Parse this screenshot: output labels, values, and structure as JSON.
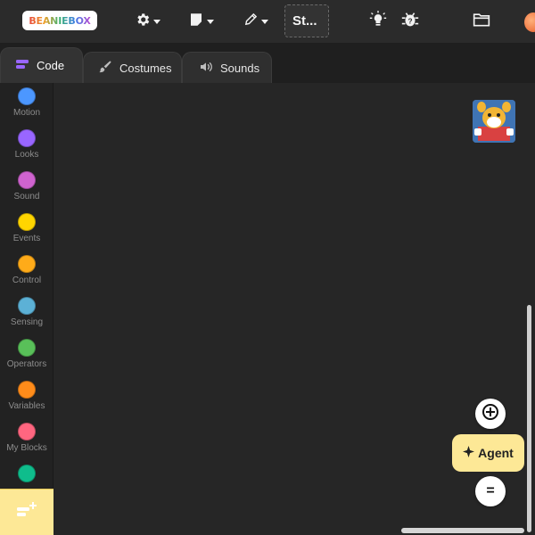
{
  "menubar": {
    "logo_text": "BEANIEBOX",
    "title_field": "St..."
  },
  "tabs": [
    {
      "label": "Code",
      "icon": "code-blocks-icon",
      "active": true
    },
    {
      "label": "Costumes",
      "icon": "brush-icon",
      "active": false
    },
    {
      "label": "Sounds",
      "icon": "speaker-icon",
      "active": false
    }
  ],
  "categories": [
    {
      "label": "Motion",
      "color": "#4c97ff"
    },
    {
      "label": "Looks",
      "color": "#9966ff"
    },
    {
      "label": "Sound",
      "color": "#cf63cf"
    },
    {
      "label": "Events",
      "color": "#ffd500"
    },
    {
      "label": "Control",
      "color": "#ffab19"
    },
    {
      "label": "Sensing",
      "color": "#5cb1d6"
    },
    {
      "label": "Operators",
      "color": "#59c059"
    },
    {
      "label": "Variables",
      "color": "#ff8c1a"
    },
    {
      "label": "My Blocks",
      "color": "#ff6680"
    },
    {
      "label": "",
      "color": "#0fbd8c"
    }
  ],
  "agent": {
    "label": "Agent"
  },
  "zoom": {
    "in_symbol": "+",
    "reset_symbol": "="
  },
  "colors": {
    "accent_yellow": "#fde896",
    "background": "#262626"
  }
}
